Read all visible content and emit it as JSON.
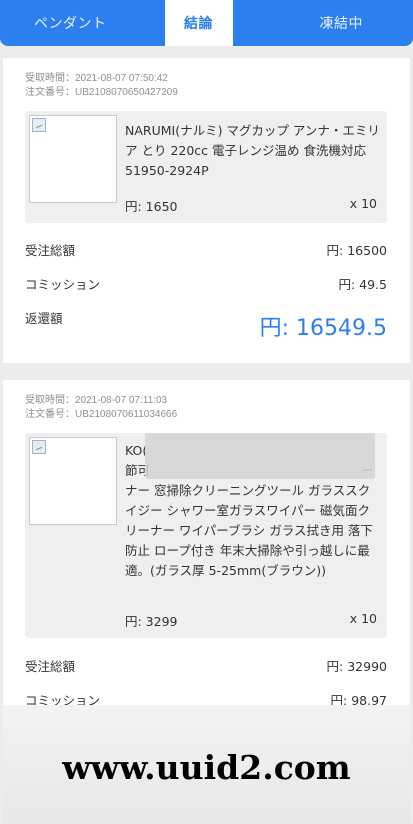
{
  "tabs": [
    {
      "label": "ペンダント"
    },
    {
      "label": "結論"
    },
    {
      "label": "凍結中"
    }
  ],
  "orders": [
    {
      "received_time": "受取時間：2021-08-07 07:50:42",
      "order_no": "注文番号：UB2108070650427209",
      "product_name": "NARUMI(ナルミ) マグカップ アンナ・エミリア とり 220cc 電子レンジ温め 食洗機対応 51950-2924P",
      "unit_price": "円: 1650",
      "quantity": "x 10",
      "total_label": "受注総額",
      "total_value": "円: 16500",
      "commission_label": "コミッション",
      "commission_value": "円: 49.5",
      "refund_label": "返還額",
      "refund_value": "円: 16549.5"
    },
    {
      "received_time": "受取時間：2021-08-07 07:11:03",
      "order_no": "注文番号：UB2108070611034666",
      "product_name_line1": "KO(",
      "product_name_line2": "節可",
      "product_name_line2b": "ー",
      "product_name_rest": "ナー 窓掃除クリーニングツール ガラススクイジー シャワー室ガラスワイパー 磁気面クリーナー ワイパーブラシ ガラス拭き用 落下防止 ロープ付き 年末大掃除や引っ越しに最適。(ガラス厚 5-25mm(ブラウン))",
      "unit_price": "円: 3299",
      "quantity": "x 10",
      "total_label": "受注総額",
      "total_value": "円: 32990",
      "commission_label": "コミッション",
      "commission_value": "円: 98.97"
    }
  ],
  "watermark": "www.uuid2.com",
  "colors": {
    "accent": "#2b7ff0",
    "background": "#ececec"
  }
}
